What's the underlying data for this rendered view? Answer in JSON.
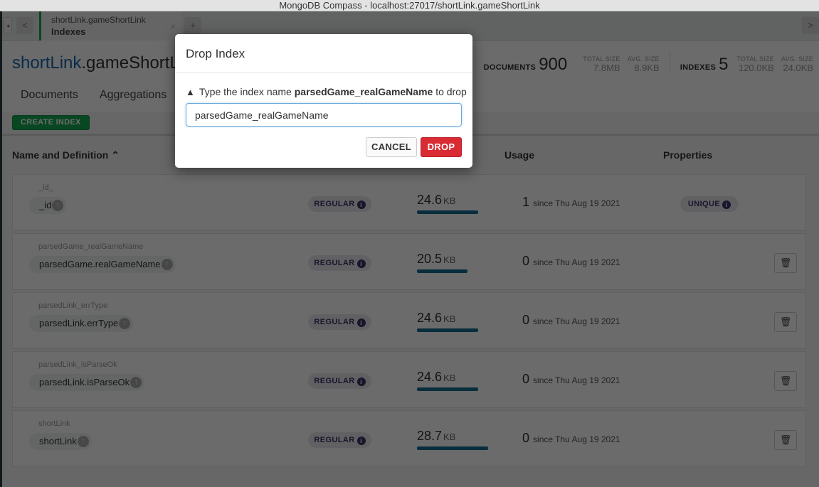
{
  "window": {
    "title": "MongoDB Compass - localhost:27017/shortLink.gameShortLink"
  },
  "tabbar": {
    "tab": {
      "namespace": "shortLink.gameShortLink",
      "subtitle": "Indexes",
      "close": "×"
    },
    "add_tab": "+",
    "prev": "<",
    "next": ">",
    "collapse": "◂"
  },
  "header": {
    "db": "shortLink",
    "collection": ".gameShortLink",
    "documents": {
      "label": "DOCUMENTS",
      "count": "900",
      "total_size_label": "TOTAL SIZE",
      "total_size": "7.8MB",
      "avg_size_label": "AVG. SIZE",
      "avg_size": "8.9KB"
    },
    "indexes": {
      "label": "INDEXES",
      "count": "5",
      "total_size_label": "TOTAL SIZE",
      "total_size": "120.0KB",
      "avg_size_label": "AVG. SIZE",
      "avg_size": "24.0KB"
    },
    "subtabs": [
      "Documents",
      "Aggregations"
    ]
  },
  "toolbar": {
    "create_index": "CREATE INDEX"
  },
  "columns": {
    "name": "Name and Definition ⌃",
    "usage": "Usage",
    "properties": "Properties"
  },
  "indexes": [
    {
      "name": "_id_",
      "field": "_id",
      "type": "REGULAR",
      "size": "24.6",
      "unit": "KB",
      "size_fraction": 0.857,
      "usage": "1",
      "since": "since Thu Aug 19 2021",
      "property": "UNIQUE",
      "droppable": false
    },
    {
      "name": "parsedGame_realGameName",
      "field": "parsedGame.realGameName",
      "type": "REGULAR",
      "size": "20.5",
      "unit": "KB",
      "size_fraction": 0.714,
      "usage": "0",
      "since": "since Thu Aug 19 2021",
      "property": "",
      "droppable": true
    },
    {
      "name": "parsedLink_errType",
      "field": "parsedLink.errType",
      "type": "REGULAR",
      "size": "24.6",
      "unit": "KB",
      "size_fraction": 0.857,
      "usage": "0",
      "since": "since Thu Aug 19 2021",
      "property": "",
      "droppable": true
    },
    {
      "name": "parsedLink_isParseOk",
      "field": "parsedLink.isParseOk",
      "type": "REGULAR",
      "size": "24.6",
      "unit": "KB",
      "size_fraction": 0.857,
      "usage": "0",
      "since": "since Thu Aug 19 2021",
      "property": "",
      "droppable": true
    },
    {
      "name": "shortLink",
      "field": "shortLink",
      "type": "REGULAR",
      "size": "28.7",
      "unit": "KB",
      "size_fraction": 1.0,
      "usage": "0",
      "since": "since Thu Aug 19 2021",
      "property": "",
      "droppable": true
    }
  ],
  "modal": {
    "title": "Drop Index",
    "message_prefix": "Type the index name",
    "message_name": "parsedGame_realGameName",
    "message_suffix": "to drop",
    "input_value": "parsedGame_realGameName",
    "cancel": "CANCEL",
    "drop": "DROP"
  },
  "colors": {
    "accent_green": "#13aa52",
    "danger_red": "#d92b33",
    "bar_blue": "#136e95",
    "db_blue": "#1a66b0"
  }
}
